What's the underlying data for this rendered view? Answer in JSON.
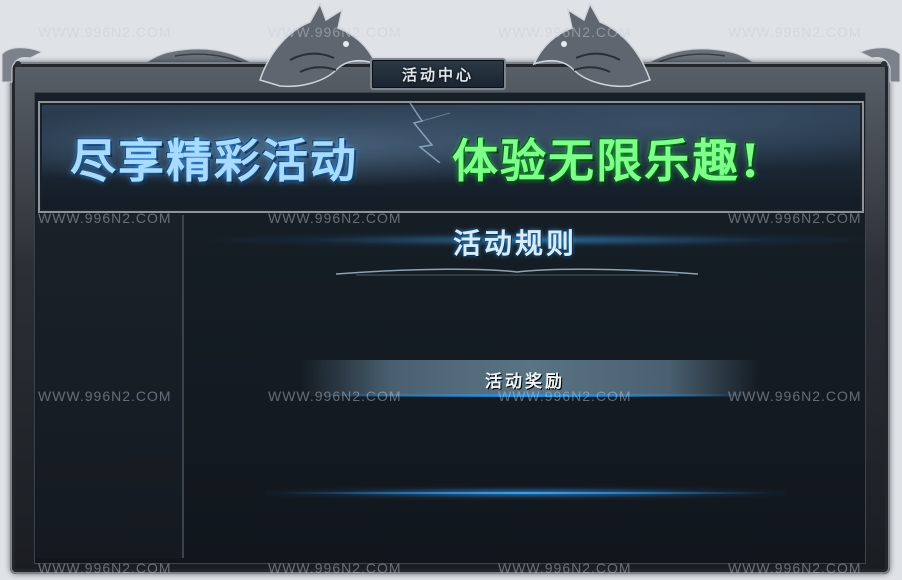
{
  "window": {
    "title": "活动中心"
  },
  "banner": {
    "left_text": "尽享精彩活动",
    "right_text": "体验无限乐趣!"
  },
  "sections": {
    "rules_title": "活动规则",
    "reward_title": "活动奖励"
  },
  "watermark": {
    "text": "WWW.996N2.COM"
  },
  "colors": {
    "banner_left": "#a9dbff",
    "banner_right": "#7dff8a",
    "accent_glow": "#2a8fe0"
  }
}
